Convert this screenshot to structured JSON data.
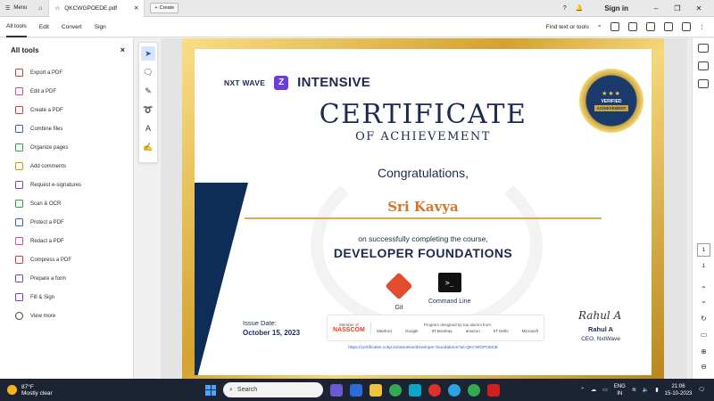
{
  "titlebar": {
    "menu_label": "Menu",
    "tab_name": "QKCWGPOEDE.pdf",
    "create_label": "Create",
    "signin_label": "Sign in"
  },
  "toolbar": {
    "tabs": [
      {
        "label": "All tools"
      },
      {
        "label": "Edit"
      },
      {
        "label": "Convert"
      },
      {
        "label": "Sign"
      }
    ],
    "find_label": "Find text or tools"
  },
  "left_panel": {
    "title": "All tools",
    "items": [
      {
        "label": "Export a PDF",
        "icon": "export-pdf-icon",
        "color": "red"
      },
      {
        "label": "Edit a PDF",
        "icon": "edit-pdf-icon",
        "color": "pink"
      },
      {
        "label": "Create a PDF",
        "icon": "create-pdf-icon",
        "color": "red"
      },
      {
        "label": "Combine files",
        "icon": "combine-files-icon",
        "color": "blue"
      },
      {
        "label": "Organize pages",
        "icon": "organize-pages-icon",
        "color": "green"
      },
      {
        "label": "Add comments",
        "icon": "comment-icon",
        "color": "yellow"
      },
      {
        "label": "Request e-signatures",
        "icon": "e-sign-icon",
        "color": "purple"
      },
      {
        "label": "Scan & OCR",
        "icon": "scan-icon",
        "color": "green"
      },
      {
        "label": "Protect a PDF",
        "icon": "protect-icon",
        "color": "blue"
      },
      {
        "label": "Redact a PDF",
        "icon": "redact-icon",
        "color": "pink"
      },
      {
        "label": "Compress a PDF",
        "icon": "compress-icon",
        "color": "red"
      },
      {
        "label": "Prepare a form",
        "icon": "form-icon",
        "color": "purple"
      },
      {
        "label": "Fill & Sign",
        "icon": "fill-sign-icon",
        "color": "purple"
      },
      {
        "label": "View more",
        "icon": "view-more-icon",
        "color": "dark"
      }
    ]
  },
  "certificate": {
    "brand_small": "NXT WAVE",
    "brand_main": "INTENSIVE",
    "badge_line1": "VERIFIED",
    "badge_line2": "ACHIEVEMENT",
    "title": "CERTIFICATE",
    "subtitle": "OF ACHIEVEMENT",
    "congrats": "Congratulations,",
    "student_name": "Sri Kavya",
    "completing_text": "on successfully completing the course,",
    "course_name": "DEVELOPER FOUNDATIONS",
    "skills": [
      {
        "label": "Git"
      },
      {
        "label": "Command Line"
      }
    ],
    "issue_label": "Issue Date:",
    "issue_date": "October 15, 2023",
    "member_of": "Member of",
    "nasscom": "NASSCOM",
    "program_text": "Program designed by top alumni from",
    "partners": [
      "Stanford",
      "Google",
      "IIT Bombay",
      "amazon",
      "IIT Delhi",
      "Microsoft"
    ],
    "verify_url": "https://certificates.ccbp.in/intensive/developer-foundations?id=QKCWGPOEDE",
    "signature": "Rahul A",
    "signer_name": "Rahul A",
    "signer_role": "CEO, NxtWave"
  },
  "right_panel": {
    "current_page": "1",
    "page_count": "1"
  },
  "taskbar": {
    "weather_temp": "87°F",
    "weather_desc": "Mostly clear",
    "search_placeholder": "Search",
    "lang_line1": "ENG",
    "lang_line2": "IN",
    "time": "21:06",
    "date": "15-10-2023"
  }
}
